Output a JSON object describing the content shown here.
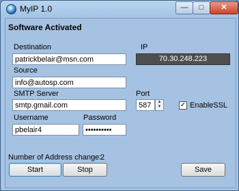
{
  "window": {
    "title": "MyIP 1.0",
    "controls": {
      "minimize": "—",
      "maximize": "□",
      "close": "✕"
    }
  },
  "status": {
    "heading": "Software Activated"
  },
  "form": {
    "destination": {
      "label": "Destination",
      "value": "patrickbelair@msn.com"
    },
    "ip": {
      "label": "IP",
      "value": "70.30.248.223"
    },
    "source": {
      "label": "Source",
      "value": "info@autosp.com"
    },
    "smtp": {
      "label": "SMTP Server",
      "value": "smtp.gmail.com"
    },
    "port": {
      "label": "Port",
      "value": "587",
      "up": "▲",
      "down": "▼"
    },
    "ssl": {
      "label": "EnableSSL",
      "checked": true,
      "mark": "✓"
    },
    "username": {
      "label": "Username",
      "value": "pbelair4"
    },
    "password": {
      "label": "Password",
      "value": "••••••••••"
    }
  },
  "footer": {
    "change_label": "Number of Address change:",
    "change_count": "2",
    "start": "Start",
    "stop": "Stop",
    "save": "Save"
  },
  "colors": {
    "accent": "#a6c2e2",
    "ip_bg": "#4f4f4f"
  }
}
